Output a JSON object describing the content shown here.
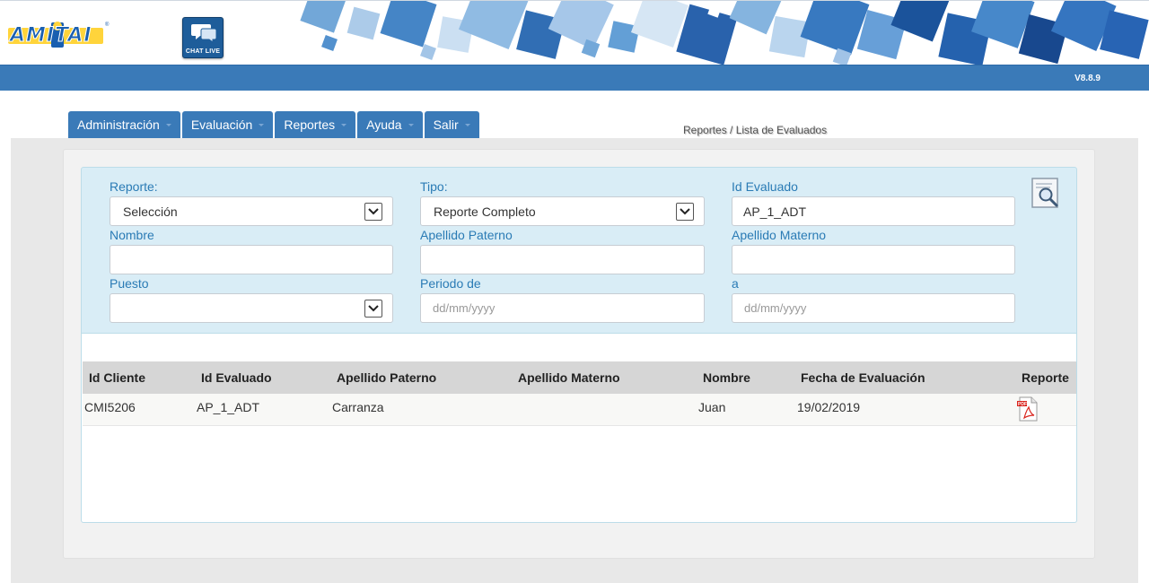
{
  "header": {
    "logo_text": "AMITAI",
    "logo_mark": "®",
    "chat_label": "CHAT LIVE",
    "version": "V8.8.9"
  },
  "nav": {
    "tabs": [
      {
        "label": "Administración"
      },
      {
        "label": "Evaluación"
      },
      {
        "label": "Reportes"
      },
      {
        "label": "Ayuda"
      },
      {
        "label": "Salir"
      }
    ]
  },
  "breadcrumb": "Reportes / Lista de Evaluados",
  "filters": {
    "reporte": {
      "label": "Reporte:",
      "value": "Selección"
    },
    "tipo": {
      "label": "Tipo:",
      "value": "Reporte Completo"
    },
    "id_evaluado": {
      "label": "Id Evaluado",
      "value": "AP_1_ADT"
    },
    "nombre": {
      "label": "Nombre",
      "value": ""
    },
    "apellido_paterno": {
      "label": "Apellido Paterno",
      "value": ""
    },
    "apellido_materno": {
      "label": "Apellido Materno",
      "value": ""
    },
    "puesto": {
      "label": "Puesto",
      "value": ""
    },
    "periodo_de": {
      "label": "Periodo de",
      "placeholder": "dd/mm/yyyy"
    },
    "periodo_a": {
      "label": "a",
      "placeholder": "dd/mm/yyyy"
    }
  },
  "table": {
    "headers": [
      "Id Cliente",
      "Id Evaluado",
      "Apellido Paterno",
      "Apellido Materno",
      "Nombre",
      "Fecha de Evaluación",
      "Reporte"
    ],
    "rows": [
      {
        "id_cliente": "CMI5206",
        "id_evaluado": "AP_1_ADT",
        "apellido_paterno": "Carranza",
        "apellido_materno": "",
        "nombre": "Juan",
        "fecha": "19/02/2019"
      }
    ]
  },
  "colors": {
    "brand_blue": "#3a7ab8",
    "label_blue": "#2a7bb5",
    "filter_bg": "#d9edf6"
  },
  "icons": [
    "chat-icon",
    "search-report-icon",
    "pdf-icon",
    "chevron-down-icon"
  ]
}
